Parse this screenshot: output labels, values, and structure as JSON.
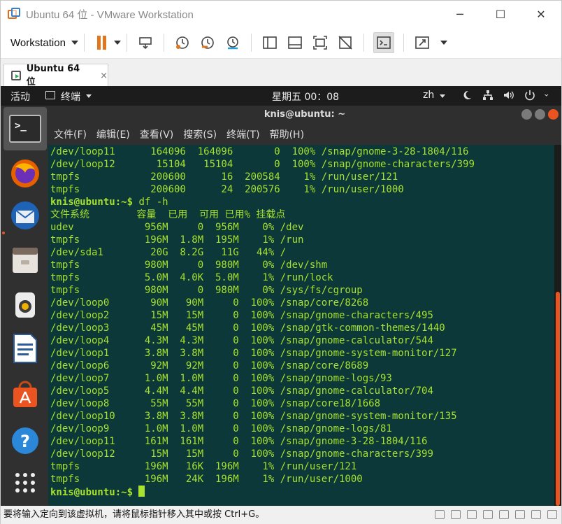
{
  "window": {
    "title": "Ubuntu 64 位 - VMware Workstation",
    "buttons": {
      "minimize": "─",
      "maximize": "☐",
      "close": "✕"
    }
  },
  "toolbar": {
    "menu_label": "Workstation",
    "icons": [
      "pause-icon",
      "send-keys-icon",
      "snapshot-take-icon",
      "snapshot-revert-icon",
      "snapshot-manager-icon",
      "library-view-icon",
      "single-window-icon",
      "fullscreen-icon",
      "unity-icon",
      "console-view-icon",
      "stretch-view-icon"
    ]
  },
  "tab": {
    "label": "Ubuntu 64 位",
    "close": "×"
  },
  "ubuntu_bar": {
    "activities": "活动",
    "app_menu": "终端",
    "clock": "星期五 00：08",
    "lang": "zh"
  },
  "dock": {
    "items": [
      "terminal",
      "firefox",
      "thunderbird",
      "files",
      "rhythmbox",
      "libreoffice-writer",
      "ubuntu-software",
      "help",
      "show-apps"
    ]
  },
  "terminal": {
    "title": "knis@ubuntu: ~",
    "menu": [
      "文件(F)",
      "编辑(E)",
      "查看(V)",
      "搜索(S)",
      "终端(T)",
      "帮助(H)"
    ],
    "lines": [
      "/dev/loop11      164096  164096       0  100% /snap/gnome-3-28-1804/116",
      "/dev/loop12       15104   15104       0  100% /snap/gnome-characters/399",
      "tmpfs            200600      16  200584    1% /run/user/121",
      "tmpfs            200600      24  200576    1% /run/user/1000"
    ],
    "prompt": "knis@ubuntu:~$",
    "command": " df -h",
    "header": "文件系统        容量  已用  可用 已用% 挂载点",
    "rows": [
      "udev            956M     0  956M    0% /dev",
      "tmpfs           196M  1.8M  195M    1% /run",
      "/dev/sda1        20G  8.2G   11G   44% /",
      "tmpfs           980M     0  980M    0% /dev/shm",
      "tmpfs           5.0M  4.0K  5.0M    1% /run/lock",
      "tmpfs           980M     0  980M    0% /sys/fs/cgroup",
      "/dev/loop0       90M   90M     0  100% /snap/core/8268",
      "/dev/loop2       15M   15M     0  100% /snap/gnome-characters/495",
      "/dev/loop3       45M   45M     0  100% /snap/gtk-common-themes/1440",
      "/dev/loop4      4.3M  4.3M     0  100% /snap/gnome-calculator/544",
      "/dev/loop1      3.8M  3.8M     0  100% /snap/gnome-system-monitor/127",
      "/dev/loop6       92M   92M     0  100% /snap/core/8689",
      "/dev/loop7      1.0M  1.0M     0  100% /snap/gnome-logs/93",
      "/dev/loop5      4.4M  4.4M     0  100% /snap/gnome-calculator/704",
      "/dev/loop8       55M   55M     0  100% /snap/core18/1668",
      "/dev/loop10     3.8M  3.8M     0  100% /snap/gnome-system-monitor/135",
      "/dev/loop9      1.0M  1.0M     0  100% /snap/gnome-logs/81",
      "/dev/loop11     161M  161M     0  100% /snap/gnome-3-28-1804/116",
      "/dev/loop12      15M   15M     0  100% /snap/gnome-characters/399",
      "tmpfs           196M   16K  196M    1% /run/user/121",
      "tmpfs           196M   24K  196M    1% /run/user/1000"
    ],
    "final_prompt": "knis@ubuntu:~$"
  },
  "statusbar": {
    "text": "要将输入定向到该虚拟机，请将鼠标指针移入其中或按 Ctrl+G。"
  },
  "colors": {
    "terminal_bg": "#0d3839",
    "terminal_fg": "#a6e22e",
    "ubuntu_orange": "#e95420",
    "vmware_orange": "#e0771f"
  }
}
